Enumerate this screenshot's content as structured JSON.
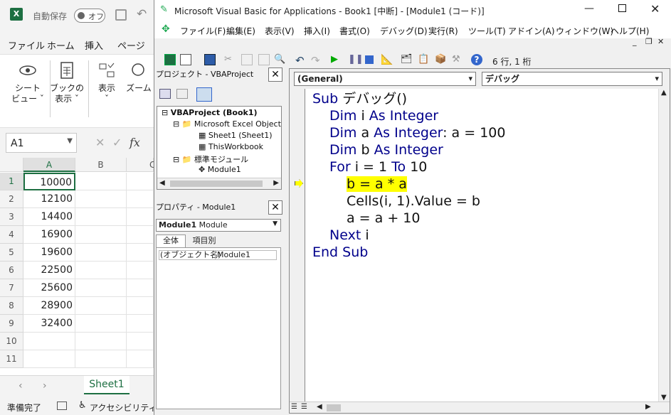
{
  "excel": {
    "autosave_label": "自動保存",
    "autosave_state": "オフ",
    "menu": [
      "ファイル",
      "ホーム",
      "挿入",
      "ページ レ"
    ],
    "ribbon": {
      "sheet_view": [
        "シート",
        "ビュー ˇ"
      ],
      "book_view": [
        "ブックの",
        "表示 ˇ"
      ],
      "show": [
        "表示",
        "ˇ"
      ],
      "zoom": "ズーム"
    },
    "name_box": "A1",
    "fx": "fx",
    "columns": [
      "A",
      "B",
      "C"
    ],
    "rows": [
      "1",
      "2",
      "3",
      "4",
      "5",
      "6",
      "7",
      "8",
      "9",
      "10",
      "11"
    ],
    "values": [
      "10000",
      "12100",
      "14400",
      "16900",
      "19600",
      "22500",
      "25600",
      "28900",
      "32400",
      "",
      ""
    ],
    "sheet_tab": "Sheet1",
    "status_ready": "準備完了",
    "status_accessibility": "アクセシビリティ: 問"
  },
  "vbe": {
    "title": "Microsoft Visual Basic for Applications - Book1 [中断] - [Module1 (コード)]",
    "menu": [
      "ファイル(F)",
      "編集(E)",
      "表示(V)",
      "挿入(I)",
      "書式(O)",
      "デバッグ(D)",
      "実行(R)",
      "ツール(T)",
      "アドイン(A)",
      "ウィンドウ(W)",
      "ヘルプ(H)"
    ],
    "position": "6 行, 1 桁",
    "project_title": "プロジェクト - VBAProject",
    "tree": {
      "root": "VBAProject (Book1)",
      "excel_objects": "Microsoft Excel Objects",
      "sheet1": "Sheet1 (Sheet1)",
      "thisworkbook": "ThisWorkbook",
      "modules": "標準モジュール",
      "module1": "Module1"
    },
    "props_title": "プロパティ - Module1",
    "props_object": "Module1",
    "props_object_type": "Module",
    "props_tabs": [
      "全体",
      "項目別"
    ],
    "props_name_key": "(オブジェクト名)",
    "props_name_val": "Module1",
    "combo_general": "(General)",
    "combo_proc": "デバッグ",
    "code_lines": [
      {
        "kw": "Sub ",
        "rest": "デバッグ()"
      },
      {
        "kw": "Dim ",
        "rest": "i As Integer"
      },
      {
        "kw": "Dim ",
        "rest": "a As Integer: a = 100"
      },
      {
        "kw": "Dim ",
        "rest": "b As Integer"
      },
      {
        "kw": "For ",
        "rest": "i = 1 To 10"
      },
      {
        "kw": "",
        "rest": "b = a * a"
      },
      {
        "kw": "",
        "rest": "Cells(i, 1).Value = b"
      },
      {
        "kw": "",
        "rest": "a = a + 10"
      },
      {
        "kw": "Next ",
        "rest": "i"
      },
      {
        "kw": "End Sub",
        "rest": ""
      }
    ],
    "highlight_color": "#ffff00"
  }
}
